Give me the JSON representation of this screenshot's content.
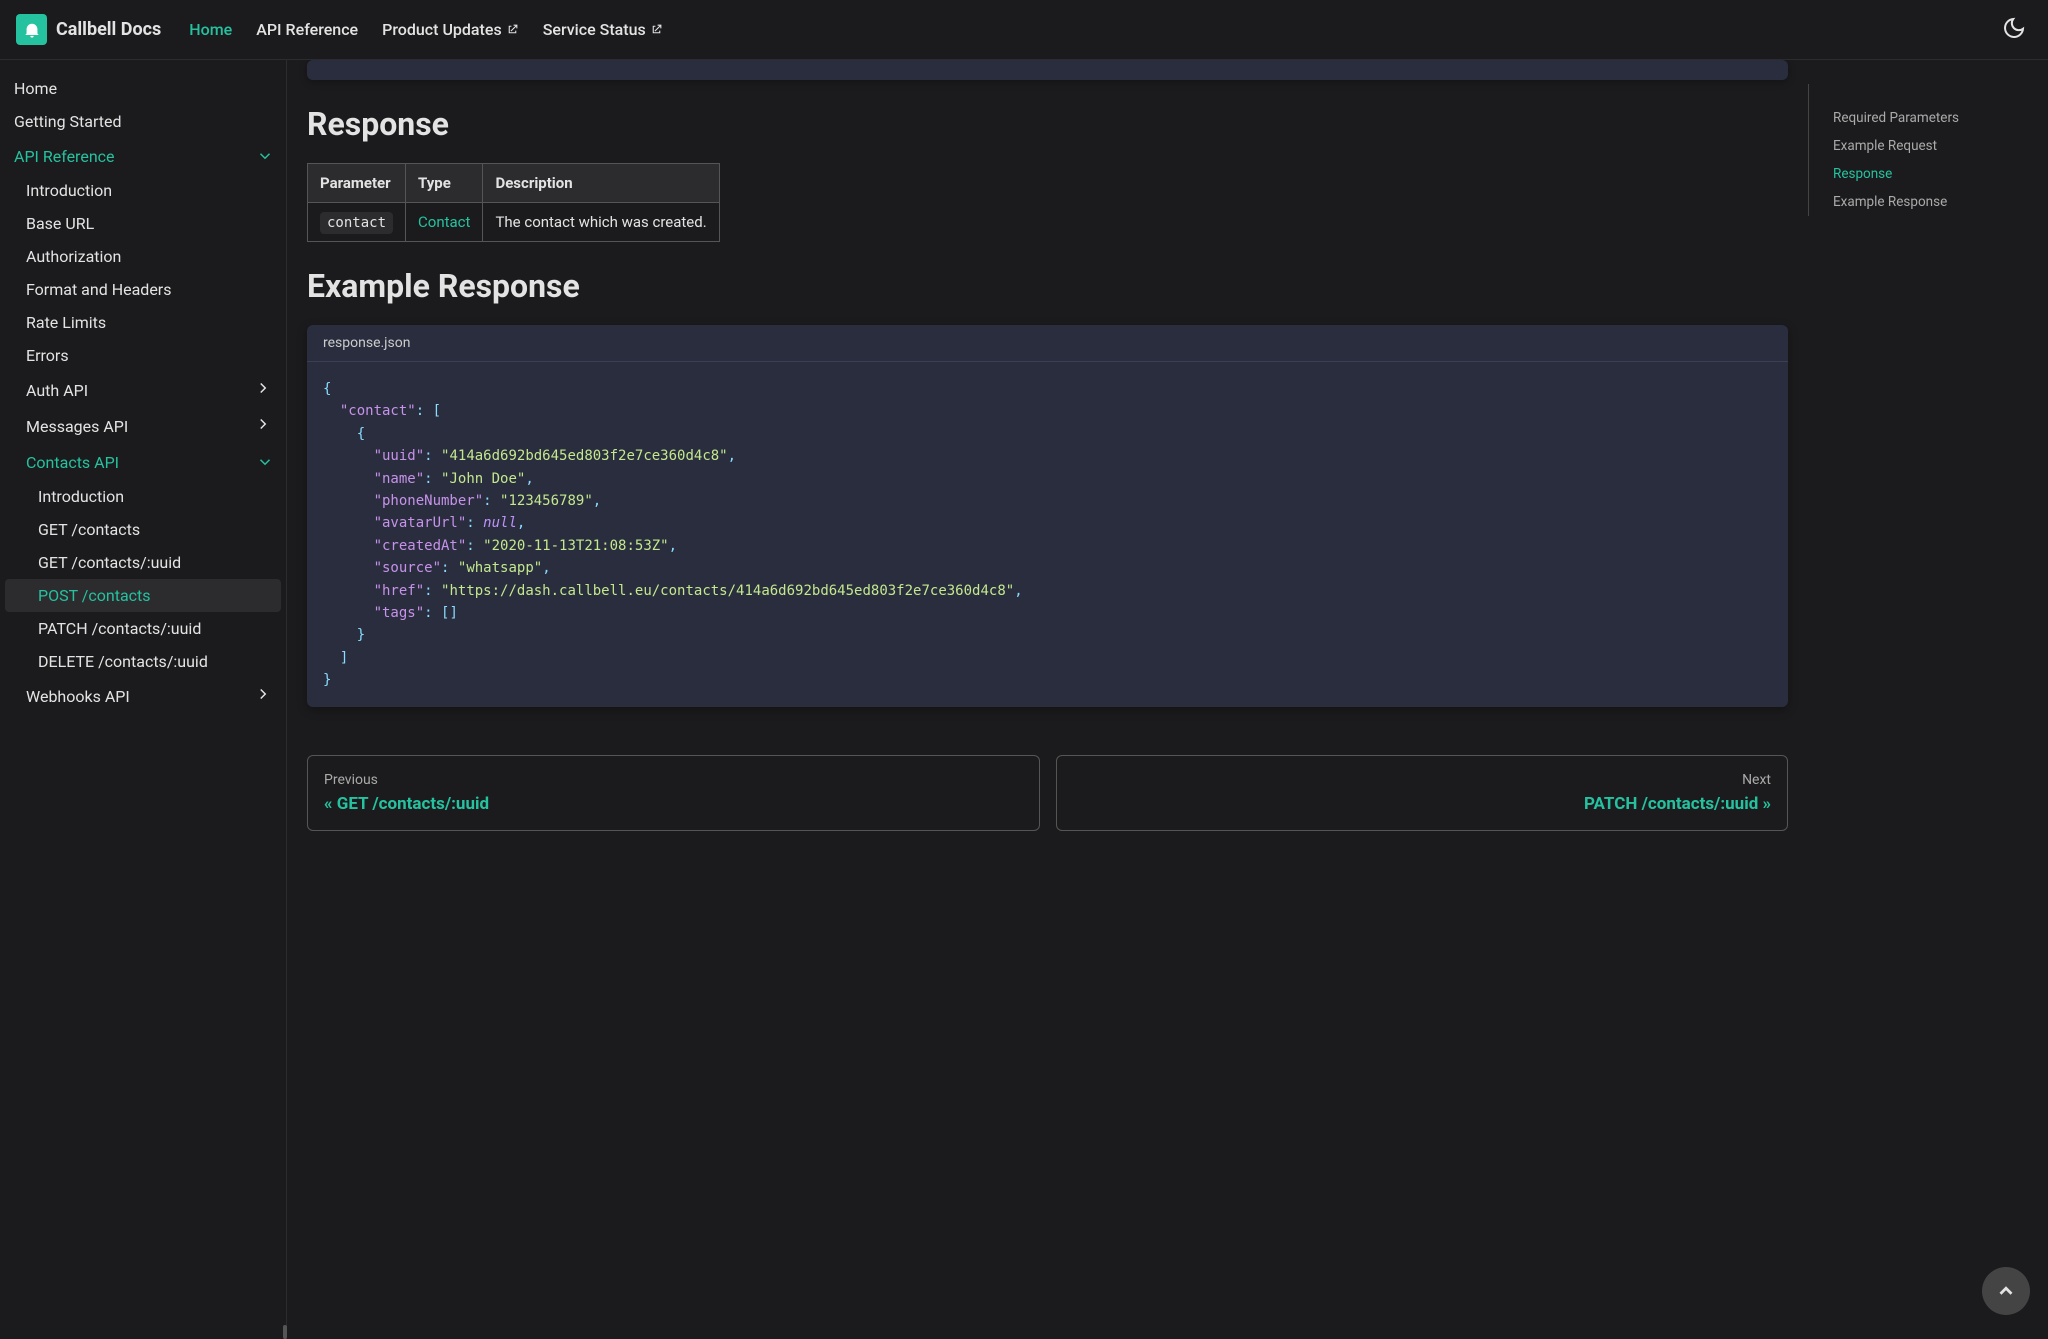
{
  "brand": "Callbell Docs",
  "topnav": [
    {
      "label": "Home",
      "active": true,
      "external": false
    },
    {
      "label": "API Reference",
      "active": false,
      "external": false
    },
    {
      "label": "Product Updates",
      "active": false,
      "external": true
    },
    {
      "label": "Service Status",
      "active": false,
      "external": true
    }
  ],
  "sidebar": {
    "rows": [
      {
        "label": "Home",
        "indent": 0,
        "chevron": "none",
        "state": "normal"
      },
      {
        "label": "Getting Started",
        "indent": 0,
        "chevron": "none",
        "state": "normal"
      },
      {
        "label": "API Reference",
        "indent": 0,
        "chevron": "open",
        "state": "active-parent"
      },
      {
        "label": "Introduction",
        "indent": 1,
        "chevron": "none",
        "state": "normal"
      },
      {
        "label": "Base URL",
        "indent": 1,
        "chevron": "none",
        "state": "normal"
      },
      {
        "label": "Authorization",
        "indent": 1,
        "chevron": "none",
        "state": "normal"
      },
      {
        "label": "Format and Headers",
        "indent": 1,
        "chevron": "none",
        "state": "normal"
      },
      {
        "label": "Rate Limits",
        "indent": 1,
        "chevron": "none",
        "state": "normal"
      },
      {
        "label": "Errors",
        "indent": 1,
        "chevron": "none",
        "state": "normal"
      },
      {
        "label": "Auth API",
        "indent": 1,
        "chevron": "closed",
        "state": "normal"
      },
      {
        "label": "Messages API",
        "indent": 1,
        "chevron": "closed",
        "state": "normal"
      },
      {
        "label": "Contacts API",
        "indent": 1,
        "chevron": "open",
        "state": "active-parent"
      },
      {
        "label": "Introduction",
        "indent": 2,
        "chevron": "none",
        "state": "normal"
      },
      {
        "label": "GET /contacts",
        "indent": 2,
        "chevron": "none",
        "state": "normal"
      },
      {
        "label": "GET /contacts/:uuid",
        "indent": 2,
        "chevron": "none",
        "state": "normal"
      },
      {
        "label": "POST /contacts",
        "indent": 2,
        "chevron": "none",
        "state": "active"
      },
      {
        "label": "PATCH /contacts/:uuid",
        "indent": 2,
        "chevron": "none",
        "state": "normal"
      },
      {
        "label": "DELETE /contacts/:uuid",
        "indent": 2,
        "chevron": "none",
        "state": "normal"
      },
      {
        "label": "Webhooks API",
        "indent": 1,
        "chevron": "closed",
        "state": "normal"
      }
    ]
  },
  "toc": [
    {
      "label": "Required Parameters",
      "active": false
    },
    {
      "label": "Example Request",
      "active": false
    },
    {
      "label": "Response",
      "active": true
    },
    {
      "label": "Example Response",
      "active": false
    }
  ],
  "main": {
    "responseHeading": "Response",
    "table": {
      "headers": [
        "Parameter",
        "Type",
        "Description"
      ],
      "row": {
        "param": "contact",
        "type": "Contact",
        "desc": "The contact which was created."
      }
    },
    "exampleHeading": "Example Response",
    "codeTitle": "response.json",
    "json": {
      "contactKey": "\"contact\"",
      "uuidKey": "\"uuid\"",
      "uuidVal": "\"414a6d692bd645ed803f2e7ce360d4c8\"",
      "nameKey": "\"name\"",
      "nameVal": "\"John Doe\"",
      "phoneKey": "\"phoneNumber\"",
      "phoneVal": "\"123456789\"",
      "avatarKey": "\"avatarUrl\"",
      "avatarVal": "null",
      "createdKey": "\"createdAt\"",
      "createdVal": "\"2020-11-13T21:08:53Z\"",
      "sourceKey": "\"source\"",
      "sourceVal": "\"whatsapp\"",
      "hrefKey": "\"href\"",
      "hrefVal": "\"https://dash.callbell.eu/contacts/414a6d692bd645ed803f2e7ce360d4c8\"",
      "tagsKey": "\"tags\""
    },
    "prev": {
      "dir": "Previous",
      "title": "« GET /contacts/:uuid"
    },
    "next": {
      "dir": "Next",
      "title": "PATCH /contacts/:uuid »"
    }
  },
  "colors": {
    "accent": "#25c2a0",
    "bg": "#1b1b1d",
    "codeBg": "#292d3e"
  }
}
